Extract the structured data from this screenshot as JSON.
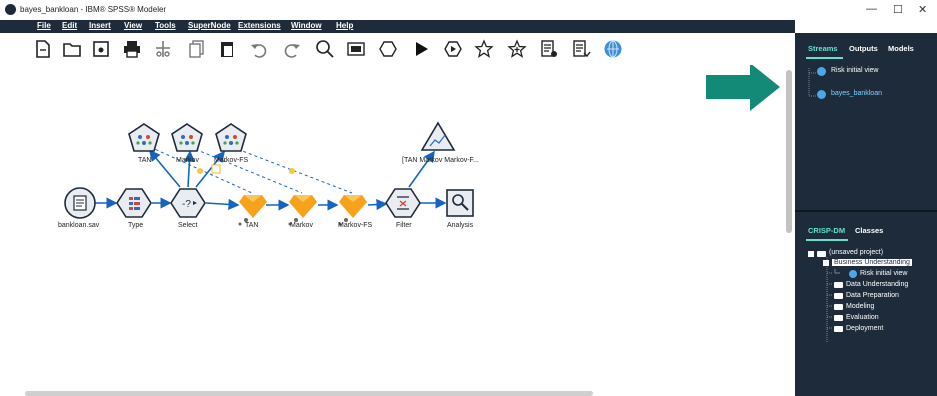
{
  "window": {
    "title": "bayes_bankloan - IBM® SPSS® Modeler",
    "minimize": "—",
    "maximize": "☐",
    "close": "✕"
  },
  "menu": [
    "File",
    "Edit",
    "Insert",
    "View",
    "Tools",
    "SuperNode",
    "Extensions",
    "Window",
    "Help"
  ],
  "toolbar_icons": [
    "new-stream-icon",
    "open-folder-icon",
    "save-icon",
    "print-icon",
    "cut-icon",
    "copy-icon",
    "paste-icon",
    "undo-icon",
    "redo-icon",
    "find-icon",
    "properties-icon",
    "supernode-icon",
    "run-icon",
    "run-selection-icon",
    "favorites-icon",
    "favorites-add-icon",
    "preview-icon",
    "preview-run-icon",
    "globe-icon"
  ],
  "nodes": {
    "bankloan": "bankloan.sav",
    "type": "Type",
    "select": "Select",
    "tan_build": "TAN",
    "markov_build": "Markov",
    "markovfs_build": "Markov-FS",
    "filter": "Filter",
    "analysis": "Analysis",
    "tan_model": "TAN",
    "markov_model": "Markov",
    "markovfs_model": "Markov-FS",
    "graph": "[TAN Markov Markov-F..."
  },
  "right_panel": {
    "top_tabs": [
      "Streams",
      "Outputs",
      "Models"
    ],
    "streams": [
      "Risk initial view",
      "bayes_bankloan"
    ],
    "bottom_tabs": [
      "CRISP-DM",
      "Classes"
    ],
    "project": {
      "root": "(unsaved project)",
      "phases": [
        "Business Understanding",
        "Risk initial view",
        "Data Understanding",
        "Data Preparation",
        "Modeling",
        "Evaluation",
        "Deployment"
      ]
    }
  },
  "colors": {
    "menubar": "#1d2b3a",
    "panel": "#1d2b3a",
    "accent": "#5fe3cc",
    "arrow": "#1565c0",
    "callout_arrow": "#138a78",
    "model_nugget": "#f7a21b"
  }
}
